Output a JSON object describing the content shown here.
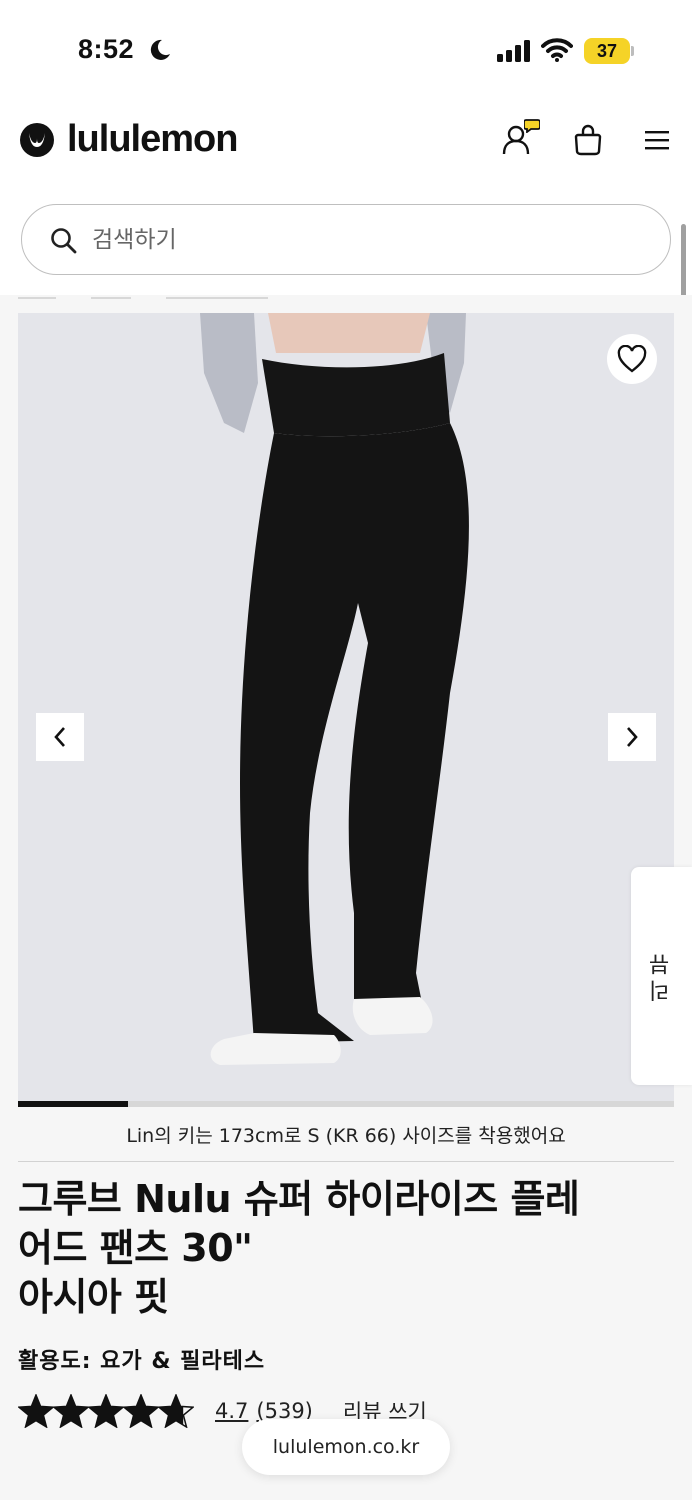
{
  "status_bar": {
    "time": "8:52",
    "battery": "37",
    "moon_icon": "moon-icon",
    "signal_icon": "signal-icon",
    "wifi_icon": "wifi-icon"
  },
  "header": {
    "logo_text": "lululemon",
    "icons": [
      "lululemon-logo-icon",
      "account-icon",
      "shopping-bag-icon",
      "menu-icon"
    ]
  },
  "search": {
    "placeholder": "검색하기",
    "icon": "search-icon"
  },
  "gallery": {
    "favorite_icon": "heart-icon",
    "prev_icon": "chevron-left-icon",
    "next_icon": "chevron-right-icon",
    "progress_fraction": 0.167,
    "model_note": "Lin의 키는 173cm로 S (KR 66) 사이즈를 착용했어요"
  },
  "review_tab": {
    "label": "리뷰"
  },
  "product": {
    "title_lines": [
      "그루브 Nulu 슈퍼 하이라이즈 플레",
      "어드 팬츠 30\"",
      "아시아 핏"
    ],
    "activity": "활용도: 요가 & 필라테스",
    "rating_stars": 4.7,
    "rating_value": "4.7",
    "review_count": "(539)",
    "write_review": "리뷰 쓰기"
  },
  "browser": {
    "url": "lululemon.co.kr"
  },
  "colors": {
    "battery": "#f5d327",
    "badge": "#f5d327",
    "text": "#111111",
    "page_bg": "#f6f6f6",
    "photo_bg": "#e4e5ea"
  }
}
